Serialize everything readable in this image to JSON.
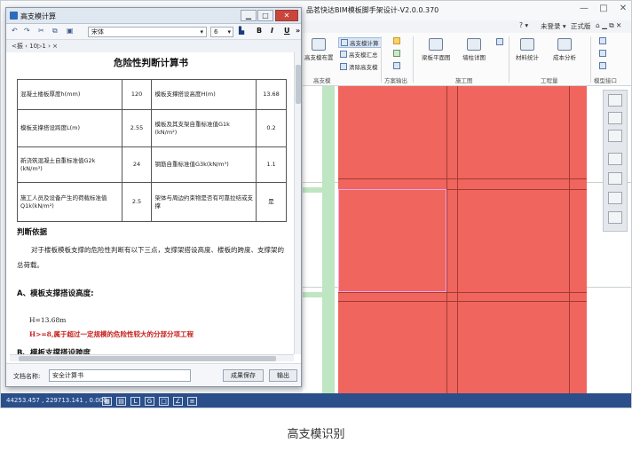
{
  "app": {
    "title": "品茗快达BIM模板脚手架设计-V2.0.0.370",
    "window_controls": [
      "—",
      "□",
      "✕"
    ],
    "menubar": {
      "help": "? ▾",
      "login": "未登录 ▾",
      "edition": "正式版",
      "icons": "⌂ ▁ ⧉ ✕"
    }
  },
  "ribbon": {
    "large_buttons": [
      {
        "label": "高支模布置"
      },
      {
        "label": "梁板平面图"
      },
      {
        "label": "墙柱详图"
      },
      {
        "label": "材料统计"
      },
      {
        "label": "成本分析"
      }
    ],
    "small_buttons": [
      {
        "label": "高支模计算"
      },
      {
        "label": "高支模汇总"
      },
      {
        "label": "清除高支模"
      }
    ],
    "groups": [
      "高支模",
      "方案输出",
      "施工图",
      "工程量",
      "模型接口"
    ]
  },
  "statusbar": {
    "coords": "44253.457 , 229713.141 , 0.000"
  },
  "dialog": {
    "title": "高支模计算",
    "toolbar": {
      "font": "宋体",
      "size": "6",
      "bold": "B",
      "italic": "I",
      "underline": "U",
      "more": "»"
    },
    "tab_nav": "<振 ‹ 10▷1 ›  ×",
    "document": {
      "title": "危险性判断计算书",
      "table": [
        {
          "l1": "混凝土楼板厚度h(mm)",
          "v1": "120",
          "l2": "模板支撑搭设高度H(m)",
          "v2": "13.68"
        },
        {
          "l1": "模板支撑搭设跨度L(m)",
          "v1": "2.55",
          "l2": "模板及其支架自重标准值G1k (kN/m²)",
          "v2": "0.2"
        },
        {
          "l1": "新浇筑混凝土自重标准值G2k (kN/m³)",
          "v1": "24",
          "l2": "钢筋自重标准值G3k(kN/m³)",
          "v2": "1.1"
        },
        {
          "l1": "施工人员及设备产生的荷载标准值Q1k(kN/m²)",
          "v1": "2.5",
          "l2": "架体与周边约束物是否有可靠拉结或支撑",
          "v2": "是"
        }
      ],
      "basis_heading": "判断依据",
      "basis_text": "对于楼板模板支撑的危险性判断有以下三点，支撑架搭设高度、楼板的跨度、支撑架的总荷载。",
      "section_a": "A、模板支撑搭设高度:",
      "h_value": "H=13.68m",
      "h_warning": "H>=8,属于超过一定规模的危险性较大的分部分项工程",
      "section_b": "B、模板支撑搭设跨度"
    },
    "footer": {
      "docname_label": "文档名称:",
      "docname_value": "安全计算书",
      "save_label": "成果保存",
      "export_label": "输出"
    }
  },
  "caption": "高支模识别"
}
